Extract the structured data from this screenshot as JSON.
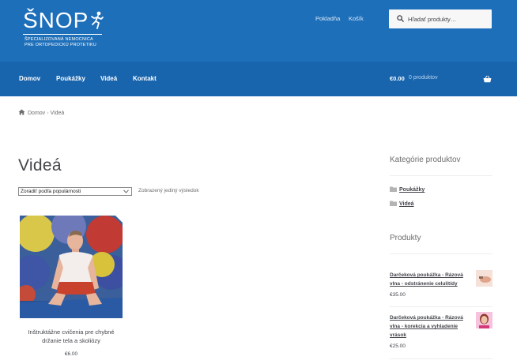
{
  "header": {
    "logo": {
      "title": "ŠNOP",
      "subtitle_line1": "ŠPECIALIZOVANÁ NEMOCNICA",
      "subtitle_line2": "PRE ORTOPEDICKÚ PROTETIKU"
    },
    "links": {
      "checkout": "Pokladňa",
      "cart": "Košík"
    },
    "search": {
      "placeholder": "Hľadať produkty…",
      "value": ""
    }
  },
  "nav": {
    "items": [
      {
        "label": "Domov"
      },
      {
        "label": "Poukážky"
      },
      {
        "label": "Videá"
      },
      {
        "label": "Kontakt"
      }
    ],
    "cart_total": "€0.00",
    "cart_count": "0 produktov"
  },
  "breadcrumb": {
    "home": "Domov",
    "separator": "›",
    "current": "Videá"
  },
  "main": {
    "title": "Videá",
    "sort_selected": "Zoradiť podľa populárnosti",
    "result_count": "Zobrazený jediný výsledok",
    "products": [
      {
        "name": "Inštruktážne cvičenia pre chybné držanie tela a skoliózy",
        "price": "€6.00"
      }
    ]
  },
  "sidebar": {
    "categories_title": "Kategórie produktov",
    "categories": [
      {
        "label": "Poukážky"
      },
      {
        "label": "Videá"
      }
    ],
    "products_title": "Produkty",
    "products": [
      {
        "name": "Darčeková poukážka - Rázová vlna - odstránenie celulitídy",
        "price": "€35.00"
      },
      {
        "name": "Darčeková poukážka - Rázová vlna - korekcia a vyhladenie vrások",
        "price": "€25.00"
      }
    ]
  },
  "colors": {
    "header_blue": "#1e6fba",
    "nav_blue": "#1865ae",
    "text": "#43454b"
  }
}
